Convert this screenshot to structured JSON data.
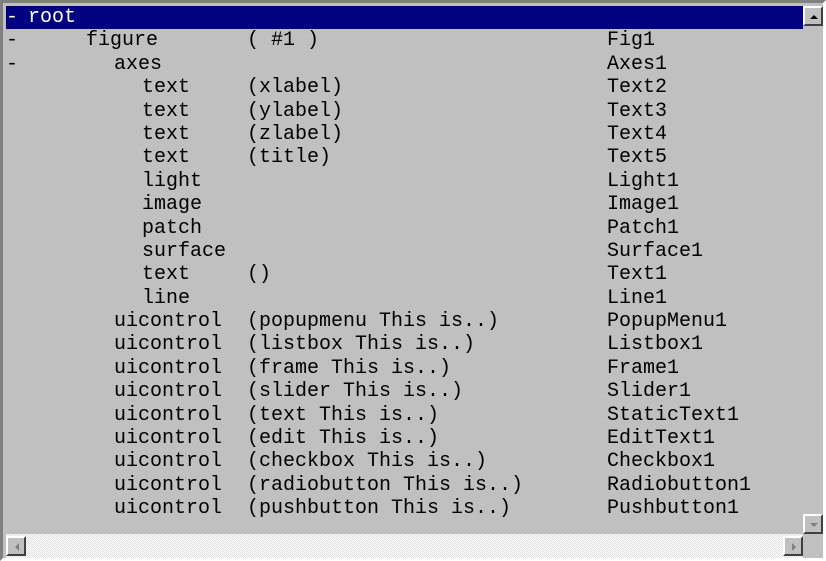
{
  "rows": [
    {
      "mark": "-",
      "name": "root",
      "desc": "",
      "tag": "",
      "indent": 0,
      "selected": true
    },
    {
      "mark": "-",
      "name": "figure",
      "desc": "( #1 )",
      "tag": "Fig1",
      "indent": 1,
      "selected": false
    },
    {
      "mark": "-",
      "name": "axes",
      "desc": "",
      "tag": "Axes1",
      "indent": 2,
      "selected": false
    },
    {
      "mark": "",
      "name": "text",
      "desc": "(xlabel)",
      "tag": "Text2",
      "indent": 3,
      "selected": false
    },
    {
      "mark": "",
      "name": "text",
      "desc": "(ylabel)",
      "tag": "Text3",
      "indent": 3,
      "selected": false
    },
    {
      "mark": "",
      "name": "text",
      "desc": "(zlabel)",
      "tag": "Text4",
      "indent": 3,
      "selected": false
    },
    {
      "mark": "",
      "name": "text",
      "desc": "(title)",
      "tag": "Text5",
      "indent": 3,
      "selected": false
    },
    {
      "mark": "",
      "name": "light",
      "desc": "",
      "tag": "Light1",
      "indent": 3,
      "selected": false
    },
    {
      "mark": "",
      "name": "image",
      "desc": "",
      "tag": "Image1",
      "indent": 3,
      "selected": false
    },
    {
      "mark": "",
      "name": "patch",
      "desc": "",
      "tag": "Patch1",
      "indent": 3,
      "selected": false
    },
    {
      "mark": "",
      "name": "surface",
      "desc": "",
      "tag": "Surface1",
      "indent": 3,
      "selected": false
    },
    {
      "mark": "",
      "name": "text",
      "desc": "()",
      "tag": "Text1",
      "indent": 3,
      "selected": false
    },
    {
      "mark": "",
      "name": "line",
      "desc": "",
      "tag": "Line1",
      "indent": 3,
      "selected": false
    },
    {
      "mark": "",
      "name": "uicontrol",
      "desc": "(popupmenu This is..)",
      "tag": "PopupMenu1",
      "indent": 2,
      "selected": false
    },
    {
      "mark": "",
      "name": "uicontrol",
      "desc": "(listbox This is..)",
      "tag": "Listbox1",
      "indent": 2,
      "selected": false
    },
    {
      "mark": "",
      "name": "uicontrol",
      "desc": "(frame This is..)",
      "tag": "Frame1",
      "indent": 2,
      "selected": false
    },
    {
      "mark": "",
      "name": "uicontrol",
      "desc": "(slider This is..)",
      "tag": "Slider1",
      "indent": 2,
      "selected": false
    },
    {
      "mark": "",
      "name": "uicontrol",
      "desc": "(text This is..)",
      "tag": "StaticText1",
      "indent": 2,
      "selected": false
    },
    {
      "mark": "",
      "name": "uicontrol",
      "desc": "(edit This is..)",
      "tag": "EditText1",
      "indent": 2,
      "selected": false
    },
    {
      "mark": "",
      "name": "uicontrol",
      "desc": "(checkbox This is..)",
      "tag": "Checkbox1",
      "indent": 2,
      "selected": false
    },
    {
      "mark": "",
      "name": "uicontrol",
      "desc": "(radiobutton This is..)",
      "tag": "Radiobutton1",
      "indent": 2,
      "selected": false
    },
    {
      "mark": "",
      "name": "uicontrol",
      "desc": "(pushbutton This is..)",
      "tag": "Pushbutton1",
      "indent": 2,
      "selected": false
    }
  ],
  "icons": {
    "scroll_up": "triangle-up-icon",
    "scroll_down": "triangle-down-icon",
    "scroll_left": "triangle-left-icon",
    "scroll_right": "triangle-right-icon"
  },
  "colors": {
    "background": "#c0c0c0",
    "selection": "#000080",
    "selection_text": "#ffffff",
    "text": "#000000"
  }
}
